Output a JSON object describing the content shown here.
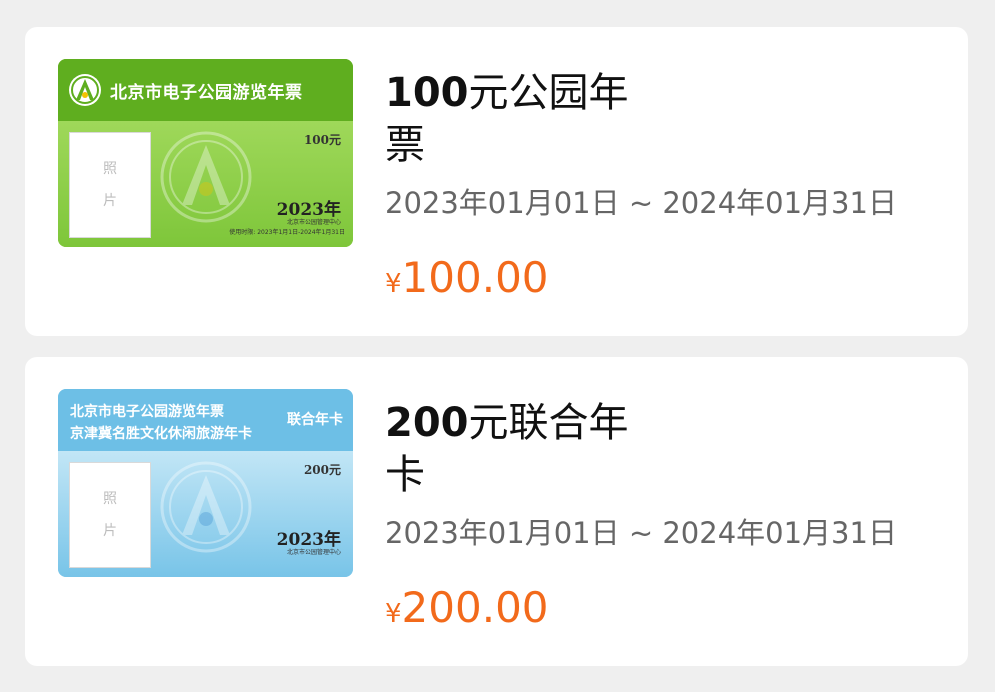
{
  "products": [
    {
      "ticket_image": {
        "title": "北京市电子公园游览年票",
        "amount": "100元",
        "photo_chars": [
          "照",
          "片"
        ],
        "year": "2023年",
        "org": "北京市公园管理中心",
        "validity": "使用时限: 2023年1月1日-2024年1月31日",
        "theme_color": "#8fce47"
      },
      "name_number": "100",
      "name_text": "元公园年票",
      "dates": "2023年01月01日 ~ 2024年01月31日",
      "currency": "¥",
      "price": "100.00"
    },
    {
      "ticket_image": {
        "title_line1": "北京市电子公园游览年票",
        "title_line2": "京津冀名胜文化休闲旅游年卡",
        "tag": "联合年卡",
        "amount": "200元",
        "photo_chars": [
          "照",
          "片"
        ],
        "year": "2023年",
        "org": "北京市公园管理中心",
        "theme_color": "#6dbfe6"
      },
      "name_number": "200",
      "name_text": "元联合年卡",
      "dates": "2023年01月01日 ~ 2024年01月31日",
      "currency": "¥",
      "price": "200.00"
    }
  ],
  "colors": {
    "price": "#f26a1b",
    "page_background": "#efefef",
    "card_background": "#ffffff"
  }
}
